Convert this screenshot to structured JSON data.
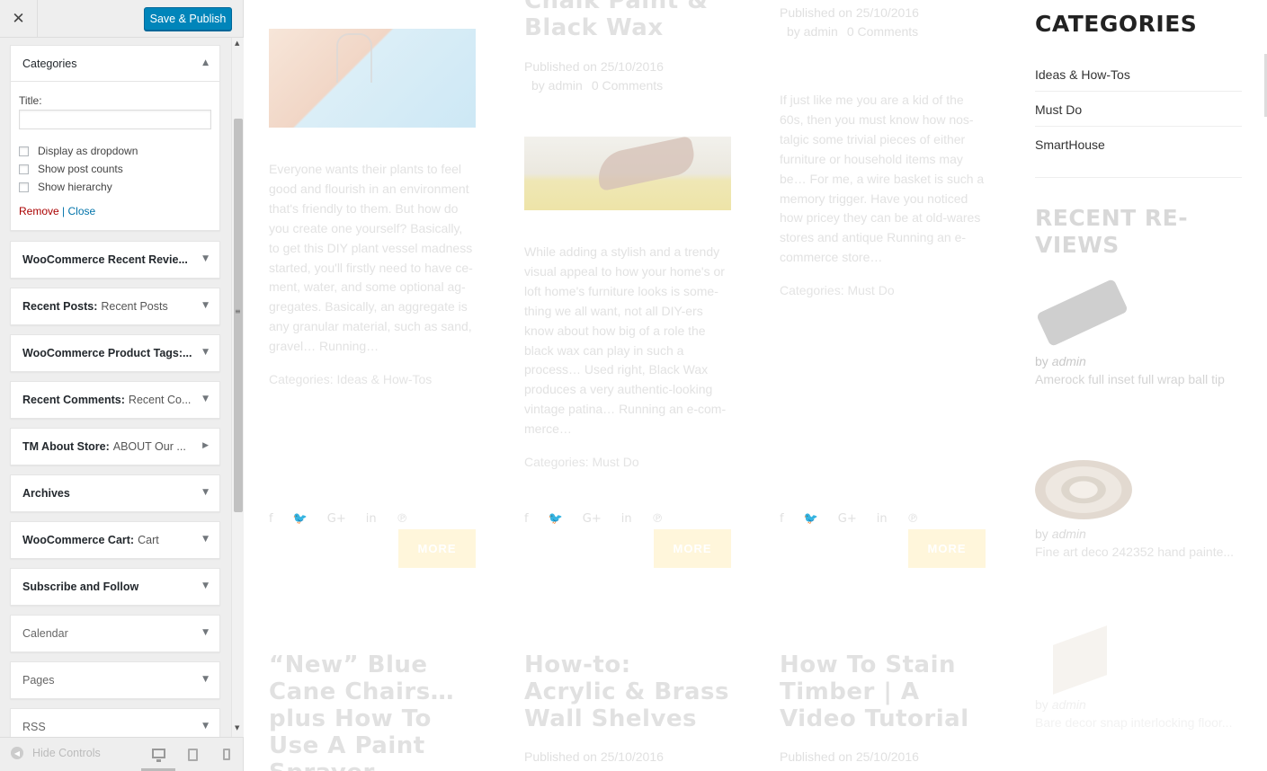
{
  "sidebar": {
    "close_glyph": "✕",
    "publish_label": "Save & Publish",
    "open_widget": {
      "title": "Categories",
      "title_field_label": "Title:",
      "title_field_value": "",
      "options": [
        "Display as dropdown",
        "Show post counts",
        "Show hierarchy"
      ],
      "remove_label": "Remove",
      "separator": "|",
      "close_label": "Close"
    },
    "widgets": [
      {
        "name": "WooCommerce Recent Revie...",
        "sub": ""
      },
      {
        "name": "Recent Posts:",
        "sub": "Recent Posts"
      },
      {
        "name": "WooCommerce Product Tags:...",
        "sub": ""
      },
      {
        "name": "Recent Comments:",
        "sub": "Recent Co..."
      },
      {
        "name": "TM About Store:",
        "sub": "ABOUT Our ..."
      },
      {
        "name": "Archives",
        "sub": ""
      },
      {
        "name": "WooCommerce Cart:",
        "sub": "Cart"
      },
      {
        "name": "Subscribe and Follow",
        "sub": ""
      },
      {
        "name": "Calendar",
        "sub": ""
      },
      {
        "name": "Pages",
        "sub": ""
      },
      {
        "name": "RSS",
        "sub": ""
      }
    ],
    "hide_controls_label": "Hide Controls"
  },
  "preview": {
    "posts": [
      {
        "excerpt": "Everyone wants their plants to feel good and flourish in an environment that's friendly to them. But how do you create one yourself? Basically, to get this DIY plant vessel madness started, you'll firstly need to have ce-ment, water, and some optional ag-gregates. Basically, an aggregate is any granular material, such as sand, gravel… Running…",
        "categories": "Categories: Ideas & How-Tos",
        "more": "MORE"
      },
      {
        "title": "Chalk Paint & Black Wax",
        "published": "Published on 25/10/2016",
        "author": "by admin",
        "comments": "0 Comments",
        "excerpt": "While adding a stylish and a trendy visual appeal to how your home's or loft home's furniture looks is some-thing we all want, not all DIY-ers know about how big of a role the black wax can play in such a process… Used right, Black Wax produces a very authentic-looking vintage patina… Running an e-com-merce…",
        "categories": "Categories: Must Do",
        "more": "MORE"
      },
      {
        "published": "Published on 25/10/2016",
        "author": "by admin",
        "comments": "0 Comments",
        "excerpt": "If just like me you are a kid of the 60s, then you must know how nos-talgic some trivial pieces of either furniture or household items may be… For me, a wire basket is such a memory trigger. Have you noticed how pricey they can be at old-wares stores and antique Running an e-commerce store…",
        "categories": "Categories: Must Do",
        "more": "MORE"
      }
    ],
    "next_posts": [
      {
        "title": "“New” Blue Cane Chairs…plus How To Use A Paint Sprayer"
      },
      {
        "title": "How-to: Acrylic & Brass Wall Shelves",
        "published": "Published on 25/10/2016"
      },
      {
        "title": "How To Stain Timber | A Video Tutorial",
        "published": "Published on 25/10/2016"
      }
    ],
    "share_icons": [
      "f",
      "🐦",
      "G+",
      "in",
      "℗"
    ],
    "categories_widget": {
      "heading": "CATEGORIES",
      "items": [
        "Ideas & How-Tos",
        "Must Do",
        "SmartHouse"
      ]
    },
    "recent_reviews": {
      "heading": "RECENT RE-VIEWS",
      "items": [
        {
          "by": "by",
          "author": "admin",
          "title": "Amerock full inset full wrap ball tip"
        },
        {
          "by": "by",
          "author": "admin",
          "title": "Fine art deco 242352 hand painte..."
        },
        {
          "by": "by",
          "author": "admin",
          "title": "Bare decor snap interlocking floor..."
        }
      ]
    }
  }
}
